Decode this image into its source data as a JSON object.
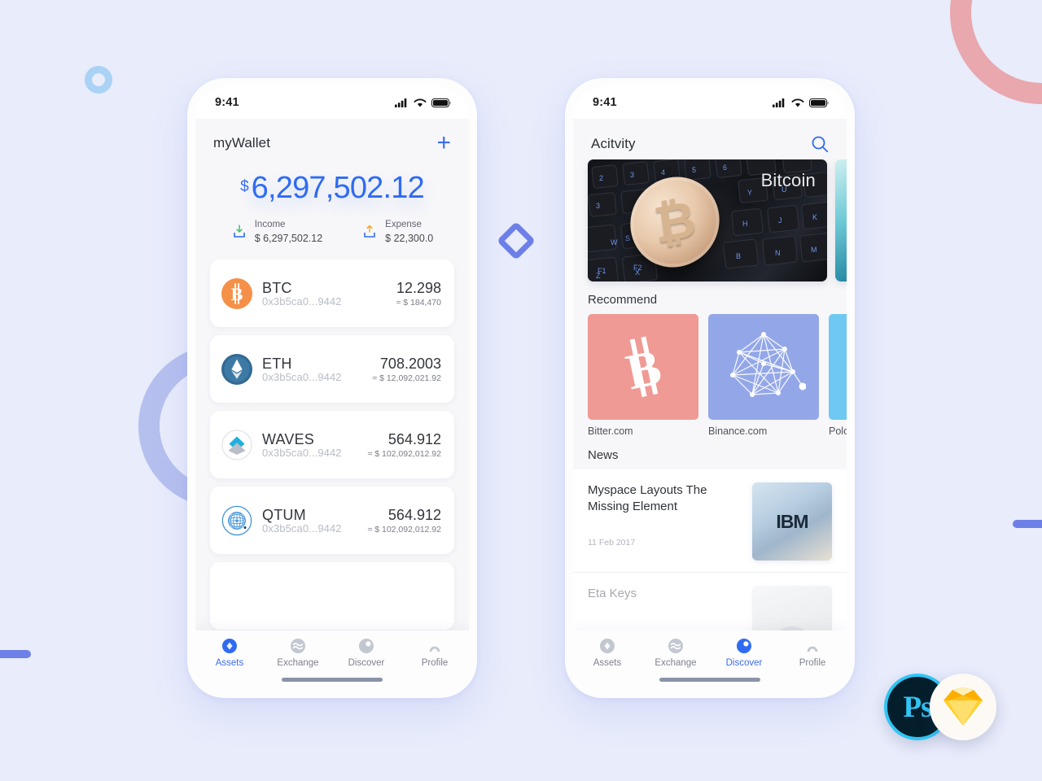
{
  "background": {
    "page_bg": "#e8ecfb",
    "decorations": [
      {
        "name": "pink-ring",
        "color": "#e9a7ae"
      },
      {
        "name": "purple-ring",
        "color": "#b6c0ee"
      },
      {
        "name": "blue-donut",
        "color": "#a9d2f5"
      },
      {
        "name": "diamond-outline",
        "color": "#6e80e8"
      },
      {
        "name": "blue-bar-left",
        "color": "#6e80e8"
      },
      {
        "name": "blue-bar-right",
        "color": "#6e80e8"
      }
    ],
    "accent_blue": "#3b6cf0"
  },
  "badges": {
    "photoshop": "Ps",
    "sketch": "sketch-diamond-icon"
  },
  "wallet_screen": {
    "status": {
      "time": "9:41",
      "signal_icon": "cellular-signal-icon",
      "wifi_icon": "wifi-icon",
      "battery_icon": "battery-full-icon"
    },
    "header": {
      "title": "myWallet",
      "add_label": "+"
    },
    "balance": {
      "currency_symbol": "$",
      "value": "6,297,502.12"
    },
    "income": {
      "icon": "download-icon",
      "label": "Income",
      "amount": "$ 6,297,502.12"
    },
    "expense": {
      "icon": "upload-icon",
      "label": "Expense",
      "amount": "$ 22,300.0"
    },
    "assets": [
      {
        "icon": "btc-coin-icon",
        "symbol": "BTC",
        "address": "0x3b5ca0...9442",
        "amount": "12.298",
        "fiat": "≈ $ 184,470"
      },
      {
        "icon": "eth-coin-icon",
        "symbol": "ETH",
        "address": "0x3b5ca0...9442",
        "amount": "708.2003",
        "fiat": "≈ $ 12,092,021.92"
      },
      {
        "icon": "waves-coin-icon",
        "symbol": "WAVES",
        "address": "0x3b5ca0...9442",
        "amount": "564.912",
        "fiat": "≈ $ 102,092,012.92"
      },
      {
        "icon": "qtum-coin-icon",
        "symbol": "QTUM",
        "address": "0x3b5ca0...9442",
        "amount": "564.912",
        "fiat": "≈ $ 102,092,012.92"
      }
    ],
    "tabs": [
      {
        "label": "Assets",
        "icon": "assets-diamond-icon",
        "active": true
      },
      {
        "label": "Exchange",
        "icon": "exchange-waves-icon",
        "active": false
      },
      {
        "label": "Discover",
        "icon": "discover-compass-icon",
        "active": false
      },
      {
        "label": "Profile",
        "icon": "profile-person-icon",
        "active": false
      }
    ]
  },
  "discover_screen": {
    "status": {
      "time": "9:41",
      "signal_icon": "cellular-signal-icon",
      "wifi_icon": "wifi-icon",
      "battery_icon": "battery-full-icon"
    },
    "header": {
      "title": "Acitvity",
      "search_icon": "search-icon"
    },
    "banners": [
      {
        "label": "Bitcoin",
        "image": "bitcoin-coin-on-keyboard"
      },
      {
        "label": "",
        "image": "teal-abstract"
      }
    ],
    "recommend": {
      "section_title": "Recommend",
      "items": [
        {
          "name": "Bitter.com",
          "icon": "bitcoin-b-icon",
          "color": "#f09a95"
        },
        {
          "name": "Binance.com",
          "icon": "network-graph-icon",
          "color": "#93a7e8"
        },
        {
          "name": "Polone",
          "icon": "partial-icon",
          "color": "#6ec8f2"
        }
      ]
    },
    "news": {
      "section_title": "News",
      "items": [
        {
          "title": "Myspace Layouts The Missing Element",
          "date": "11 Feb 2017",
          "thumb": "ibm-server-photo",
          "thumb_mark": "IBM"
        },
        {
          "title": "Eta Keys",
          "date": "",
          "thumb": "person-photo",
          "thumb_mark": ""
        }
      ]
    },
    "tabs": [
      {
        "label": "Assets",
        "icon": "assets-diamond-icon",
        "active": false
      },
      {
        "label": "Exchange",
        "icon": "exchange-waves-icon",
        "active": false
      },
      {
        "label": "Discover",
        "icon": "discover-compass-icon",
        "active": true
      },
      {
        "label": "Profile",
        "icon": "profile-person-icon",
        "active": false
      }
    ]
  }
}
